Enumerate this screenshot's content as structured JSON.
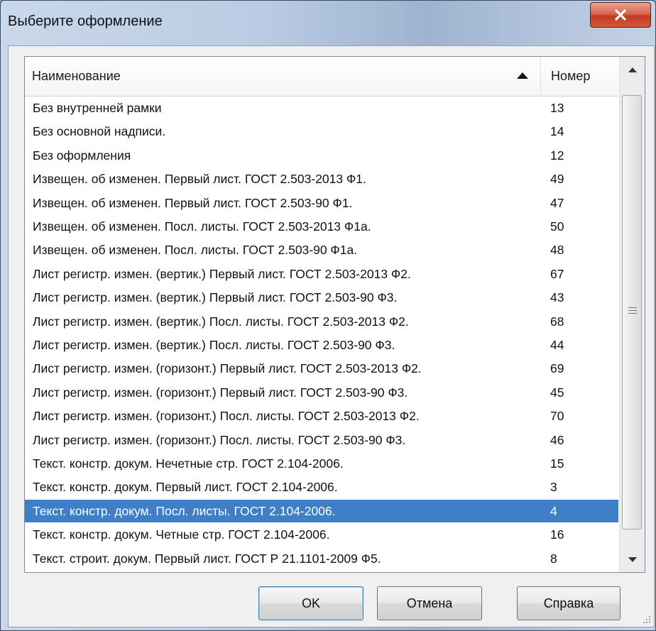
{
  "window": {
    "title": "Выберите оформление",
    "close_icon": "close-x-icon"
  },
  "list": {
    "columns": {
      "name": "Наименование",
      "number": "Номер"
    },
    "sort": {
      "column": "name",
      "direction": "ascending",
      "icon": "sort-up-icon"
    },
    "rows": [
      {
        "name": "Без внутренней рамки",
        "number": "13"
      },
      {
        "name": "Без основной надписи.",
        "number": "14"
      },
      {
        "name": "Без оформления",
        "number": "12"
      },
      {
        "name": "Извещен. об изменен. Первый лист. ГОСТ 2.503-2013 Ф1.",
        "number": "49"
      },
      {
        "name": "Извещен. об изменен. Первый лист. ГОСТ 2.503-90 Ф1.",
        "number": "47"
      },
      {
        "name": "Извещен. об изменен. Посл. листы. ГОСТ 2.503-2013 Ф1а.",
        "number": "50"
      },
      {
        "name": "Извещен. об изменен. Посл. листы. ГОСТ 2.503-90 Ф1а.",
        "number": "48"
      },
      {
        "name": "Лист регистр. измен. (вертик.) Первый лист. ГОСТ 2.503-2013 Ф2.",
        "number": "67"
      },
      {
        "name": "Лист регистр. измен. (вертик.) Первый лист. ГОСТ 2.503-90 Ф3.",
        "number": "43"
      },
      {
        "name": "Лист регистр. измен. (вертик.) Посл. листы. ГОСТ 2.503-2013 Ф2.",
        "number": "68"
      },
      {
        "name": "Лист регистр. измен. (вертик.) Посл. листы. ГОСТ 2.503-90 Ф3.",
        "number": "44"
      },
      {
        "name": "Лист регистр. измен. (горизонт.) Первый лист. ГОСТ 2.503-2013 Ф2.",
        "number": "69"
      },
      {
        "name": "Лист регистр. измен. (горизонт.) Первый лист. ГОСТ 2.503-90 Ф3.",
        "number": "45"
      },
      {
        "name": "Лист регистр. измен. (горизонт.) Посл. листы. ГОСТ 2.503-2013 Ф2.",
        "number": "70"
      },
      {
        "name": "Лист регистр. измен. (горизонт.) Посл. листы. ГОСТ 2.503-90 Ф3.",
        "number": "46"
      },
      {
        "name": "Текст. констр. докум. Нечетные стр. ГОСТ 2.104-2006.",
        "number": "15"
      },
      {
        "name": "Текст. констр. докум. Первый лист. ГОСТ 2.104-2006.",
        "number": "3"
      },
      {
        "name": "Текст. констр. докум. Посл. листы. ГОСТ 2.104-2006.",
        "number": "4",
        "selected": true
      },
      {
        "name": "Текст. констр. докум. Четные стр. ГОСТ 2.104-2006.",
        "number": "16"
      },
      {
        "name": "Текст. строит. докум. Первый лист. ГОСТ Р 21.1101-2009 Ф5.",
        "number": "8"
      }
    ]
  },
  "buttons": {
    "ok": "OK",
    "cancel": "Отмена",
    "help": "Справка"
  },
  "colors": {
    "selection": "#3f7fc8",
    "close_button": "#c23b22",
    "dialog_background": "#f0f0f0"
  }
}
